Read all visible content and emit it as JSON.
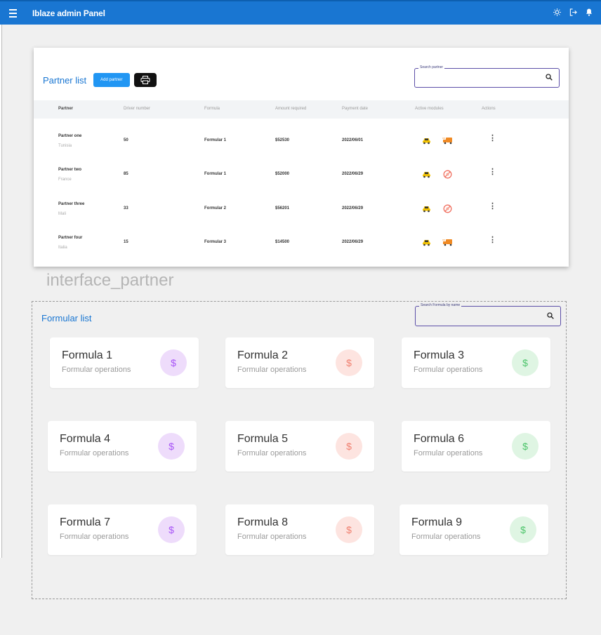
{
  "appbar": {
    "title": "Iblaze admin Panel",
    "icons": [
      "menu-icon",
      "sun-icon",
      "logout-icon",
      "bell-icon"
    ]
  },
  "partner_list": {
    "title": "Partner list",
    "add_label": "Add partner",
    "search_label": "Search partner",
    "columns": [
      "Partner",
      "Driver number",
      "Formula",
      "Amount required",
      "Payment date",
      "Active modules",
      "Actions"
    ],
    "rows": [
      {
        "name": "Partner one",
        "country": "Tunisia",
        "drivers": "50",
        "formula": "Formular 1",
        "amount": "$52530",
        "date": "2022/06/01",
        "modules": [
          "taxi-icon",
          "delivery-icon"
        ]
      },
      {
        "name": "Partner two",
        "country": "France",
        "drivers": "85",
        "formula": "Formular 1",
        "amount": "$52000",
        "date": "2022/06/29",
        "modules": [
          "taxi-icon",
          "blocked-icon"
        ]
      },
      {
        "name": "Partner three",
        "country": "Mali",
        "drivers": "33",
        "formula": "Formular 2",
        "amount": "$56201",
        "date": "2022/06/29",
        "modules": [
          "taxi-icon",
          "blocked-icon"
        ]
      },
      {
        "name": "Partner four",
        "country": "Italia",
        "drivers": "15",
        "formula": "Formular 3",
        "amount": "$14500",
        "date": "2022/06/29",
        "modules": [
          "taxi-icon",
          "delivery-icon"
        ]
      }
    ]
  },
  "caption": "interface_partner",
  "formula_list": {
    "title": "Formular list",
    "search_label": "Search Formula by name",
    "cards": [
      {
        "name": "Formula 1",
        "subtitle": "Formular operations",
        "symbol": "$",
        "color": "purple"
      },
      {
        "name": "Formula 2",
        "subtitle": "Formular operations",
        "symbol": "$",
        "color": "red"
      },
      {
        "name": "Formula 3",
        "subtitle": "Formular operations",
        "symbol": "$",
        "color": "green"
      },
      {
        "name": "Formula 4",
        "subtitle": "Formular operations",
        "symbol": "$",
        "color": "purple"
      },
      {
        "name": "Formula 5",
        "subtitle": "Formular operations",
        "symbol": "$",
        "color": "red"
      },
      {
        "name": "Formula 6",
        "subtitle": "Formular operations",
        "symbol": "$",
        "color": "green"
      },
      {
        "name": "Formula 7",
        "subtitle": "Formular operations",
        "symbol": "$",
        "color": "purple"
      },
      {
        "name": "Formula 8",
        "subtitle": "Formular operations",
        "symbol": "$",
        "color": "red"
      },
      {
        "name": "Formula 9",
        "subtitle": "Formular operations",
        "symbol": "$",
        "color": "green"
      }
    ]
  },
  "colors": {
    "primary": "#1976d2",
    "accent": "#2196f3",
    "purple": "#a855f7",
    "red": "#f08070",
    "green": "#4cc46a"
  }
}
